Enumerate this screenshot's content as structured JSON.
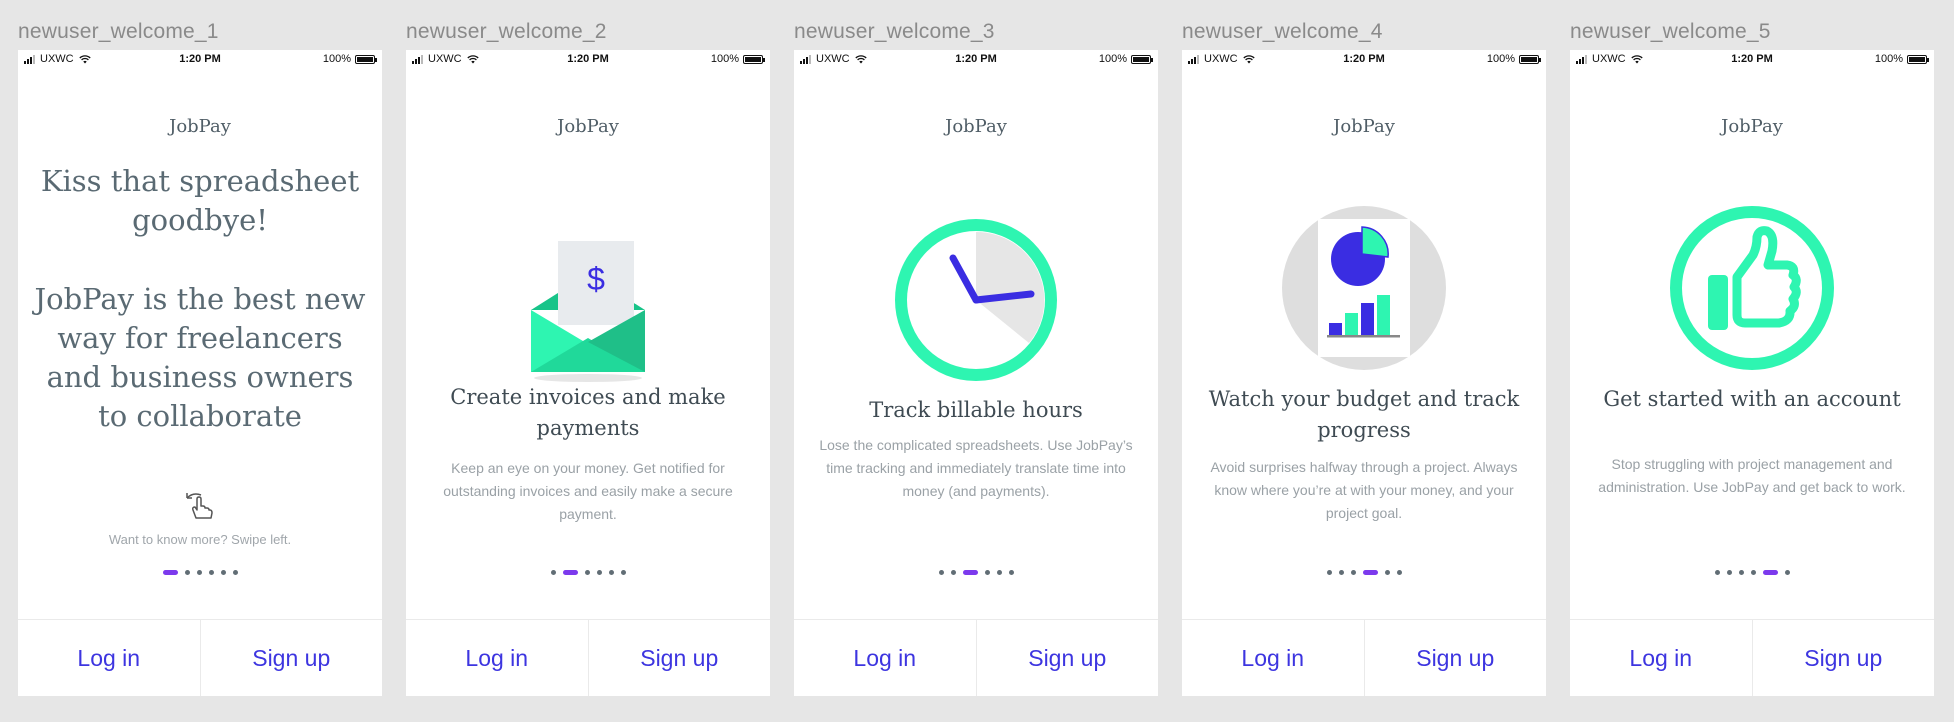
{
  "status_bar": {
    "carrier": "UXWC",
    "time": "1:20 PM",
    "battery": "100%"
  },
  "brand": "JobPay",
  "footer": {
    "login_label": "Log in",
    "signup_label": "Sign up"
  },
  "colors": {
    "accent": "#7c3aed",
    "button_text": "#3d35e0",
    "mint": "#2ef5b1",
    "indigo": "#3a2de2"
  },
  "screens": [
    {
      "artboard_label": "newuser_welcome_1",
      "headline": "Kiss that spreadsheet goodbye!",
      "subheadline": "JobPay is the best new way for freelancers and business owners to collaborate",
      "icon": "swipe-hand-icon",
      "hint": "Want to know more? Swipe left.",
      "active_dot": 0
    },
    {
      "artboard_label": "newuser_welcome_2",
      "icon": "invoice-envelope-icon",
      "title": "Create invoices and make payments",
      "description": "Keep an eye on your money. Get notified for outstanding invoices and easily make a secure payment.",
      "active_dot": 1
    },
    {
      "artboard_label": "newuser_welcome_3",
      "icon": "clock-icon",
      "title": "Track billable hours",
      "description": "Lose the complicated spreadsheets. Use JobPay’s time tracking and immediately translate time into money (and payments).",
      "active_dot": 2
    },
    {
      "artboard_label": "newuser_welcome_4",
      "icon": "budget-chart-icon",
      "title": "Watch your budget and track progress",
      "description": "Avoid surprises halfway through a project. Always know where you’re at with your money, and your project goal.",
      "active_dot": 3
    },
    {
      "artboard_label": "newuser_welcome_5",
      "icon": "thumbs-up-icon",
      "title": "Get started with an account",
      "description": "Stop struggling with project management and administration. Use JobPay and get back to work.",
      "active_dot": 4
    }
  ],
  "dot_count": 6
}
